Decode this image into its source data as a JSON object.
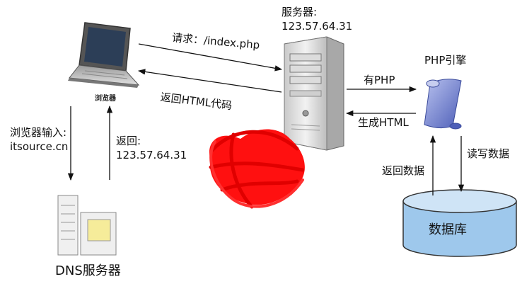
{
  "nodes": {
    "browser_label": "浏览器",
    "server_label": "服务器:",
    "server_ip": "123.57.64.31",
    "php_engine_label": "PHP引擎",
    "dns_label": "DNS服务器",
    "database_label": "数据库"
  },
  "edges": {
    "request_label": "请求：/index.php",
    "return_html_label": "返回HTML代码",
    "has_php_label": "有PHP",
    "gen_html_label": "生成HTML",
    "browser_input_label_1": "浏览器输入:",
    "browser_input_label_2": "itsource.cn",
    "dns_return_label_1": "返回:",
    "dns_return_label_2": "123.57.64.31",
    "db_return_label": "返回数据",
    "rw_data_label": "读写数据"
  },
  "colors": {
    "scribble": "#ff1010",
    "database_fill": "#9ec8ec",
    "database_top": "#cfe4f6",
    "php_scroll": "#7e8fd8"
  }
}
